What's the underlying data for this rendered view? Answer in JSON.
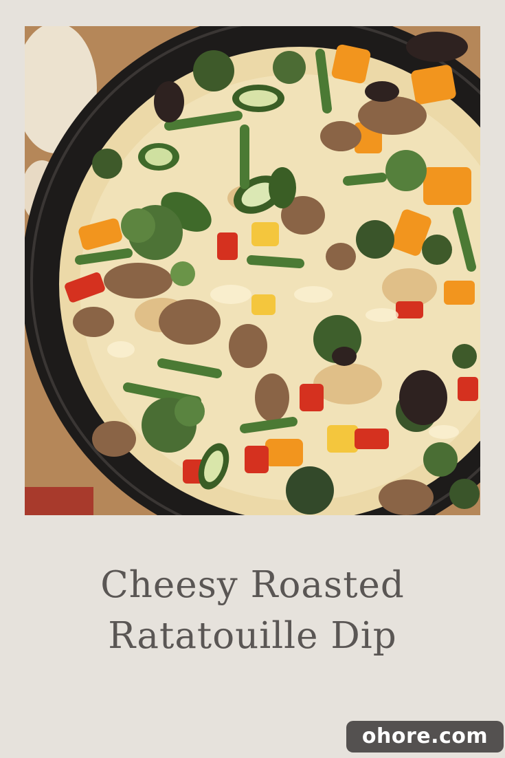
{
  "title": {
    "line1": "Cheesy Roasted",
    "line2": "Ratatouille Dip"
  },
  "brand": {
    "label": "ohore.com"
  },
  "colors": {
    "background": "#e6e2dc",
    "title_text": "#5a5654",
    "brand_badge": "#545150"
  }
}
